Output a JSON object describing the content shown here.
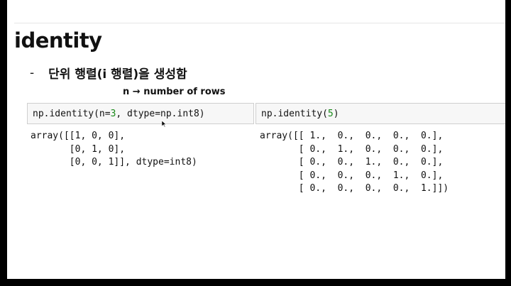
{
  "slide": {
    "title": "identity",
    "bullet": {
      "dash": "-",
      "text": "단위 행렬(i 행렬)을 생성함"
    },
    "note": "n → number of rows"
  },
  "cells": [
    {
      "input_prefix": "np.identity(n=",
      "input_number": "3",
      "input_suffix": ", dtype=np.int8)",
      "output": "array([[1, 0, 0],\n       [0, 1, 0],\n       [0, 0, 1]], dtype=int8)"
    },
    {
      "input_prefix": "np.identity(",
      "input_number": "5",
      "input_suffix": ")",
      "output": "array([[ 1.,  0.,  0.,  0.,  0.],\n       [ 0.,  1.,  0.,  0.,  0.],\n       [ 0.,  0.,  1.,  0.,  0.],\n       [ 0.,  0.,  0.,  1.,  0.],\n       [ 0.,  0.,  0.,  0.,  1.]])"
    }
  ],
  "colors": {
    "number": "#1a8a1a",
    "input_bg": "#f7f7f7",
    "input_border": "#cfcfcf"
  }
}
